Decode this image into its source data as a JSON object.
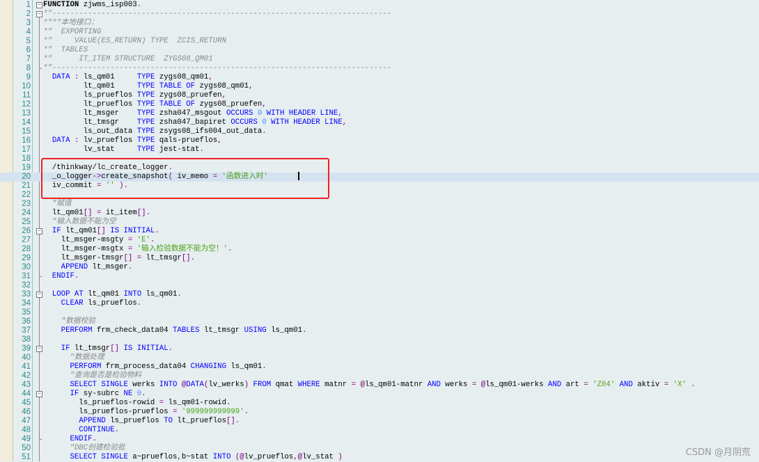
{
  "editor": {
    "current_line": 20,
    "fold_open_lines": [
      1,
      2,
      26,
      33,
      39,
      44
    ],
    "fold_end_lines": [
      8,
      31,
      49
    ],
    "highlighted_lines": [
      19,
      21
    ],
    "lines": [
      [
        [
          "kb",
          "FUNCTION"
        ],
        [
          "t",
          " zjwms_isp003"
        ],
        [
          "o",
          "."
        ]
      ],
      [
        [
          "c",
          "*\"----------------------------------------------------------------------------"
        ]
      ],
      [
        [
          "c",
          "*\"*\"本地接口："
        ]
      ],
      [
        [
          "c",
          "*\"  EXPORTING"
        ]
      ],
      [
        [
          "c",
          "*\"     VALUE(ES_RETURN) TYPE  ZCIS_RETURN"
        ]
      ],
      [
        [
          "c",
          "*\"  TABLES"
        ]
      ],
      [
        [
          "c",
          "*\"      IT_ITEM STRUCTURE  ZYGS08_QM01"
        ]
      ],
      [
        [
          "c",
          "*\"----------------------------------------------------------------------------"
        ]
      ],
      [
        [
          "t",
          "  "
        ],
        [
          "k",
          "DATA"
        ],
        [
          "t",
          " "
        ],
        [
          "o",
          ":"
        ],
        [
          "t",
          " ls_qm01     "
        ],
        [
          "k",
          "TYPE"
        ],
        [
          "t",
          " zygs08_qm01"
        ],
        [
          "o",
          ","
        ]
      ],
      [
        [
          "t",
          "         lt_qm01     "
        ],
        [
          "k",
          "TYPE"
        ],
        [
          "t",
          " "
        ],
        [
          "k",
          "TABLE OF"
        ],
        [
          "t",
          " zygs08_qm01"
        ],
        [
          "o",
          ","
        ]
      ],
      [
        [
          "t",
          "         ls_prueflos "
        ],
        [
          "k",
          "TYPE"
        ],
        [
          "t",
          " zygs08_pruefen"
        ],
        [
          "o",
          ","
        ]
      ],
      [
        [
          "t",
          "         lt_prueflos "
        ],
        [
          "k",
          "TYPE"
        ],
        [
          "t",
          " "
        ],
        [
          "k",
          "TABLE OF"
        ],
        [
          "t",
          " zygs08_pruefen"
        ],
        [
          "o",
          ","
        ]
      ],
      [
        [
          "t",
          "         lt_msger    "
        ],
        [
          "k",
          "TYPE"
        ],
        [
          "t",
          " zsha047_msgout "
        ],
        [
          "k",
          "OCCURS"
        ],
        [
          "t",
          " "
        ],
        [
          "n",
          "0"
        ],
        [
          "t",
          " "
        ],
        [
          "k",
          "WITH HEADER LINE"
        ],
        [
          "o",
          ","
        ]
      ],
      [
        [
          "t",
          "         lt_tmsgr    "
        ],
        [
          "k",
          "TYPE"
        ],
        [
          "t",
          " zsha047_bapiret "
        ],
        [
          "k",
          "OCCURS"
        ],
        [
          "t",
          " "
        ],
        [
          "n",
          "0"
        ],
        [
          "t",
          " "
        ],
        [
          "k",
          "WITH HEADER LINE"
        ],
        [
          "o",
          ","
        ]
      ],
      [
        [
          "t",
          "         ls_out_data "
        ],
        [
          "k",
          "TYPE"
        ],
        [
          "t",
          " zsygs08_ifs004_out_data"
        ],
        [
          "o",
          "."
        ]
      ],
      [
        [
          "t",
          "  "
        ],
        [
          "k",
          "DATA"
        ],
        [
          "t",
          " "
        ],
        [
          "o",
          ":"
        ],
        [
          "t",
          " lv_prueflos "
        ],
        [
          "k",
          "TYPE"
        ],
        [
          "t",
          " qals-prueflos"
        ],
        [
          "o",
          ","
        ]
      ],
      [
        [
          "t",
          "         lv_stat     "
        ],
        [
          "k",
          "TYPE"
        ],
        [
          "t",
          " jest-stat"
        ],
        [
          "o",
          "."
        ]
      ],
      [],
      [
        [
          "t",
          "  /thinkway/lc_create_logger"
        ],
        [
          "o",
          "."
        ]
      ],
      [
        [
          "t",
          "  _o_logger"
        ],
        [
          "o",
          "->"
        ],
        [
          "t",
          "create_snapshot"
        ],
        [
          "o",
          "("
        ],
        [
          "t",
          " iv_memo "
        ],
        [
          "o",
          "="
        ],
        [
          "t",
          " "
        ],
        [
          "s",
          "'函数进入时'"
        ]
      ],
      [
        [
          "t",
          "  iv_commit "
        ],
        [
          "o",
          "="
        ],
        [
          "t",
          " "
        ],
        [
          "s",
          "''"
        ],
        [
          "t",
          " "
        ],
        [
          "o",
          ")."
        ]
      ],
      [],
      [
        [
          "c",
          "  \"赋值"
        ]
      ],
      [
        [
          "t",
          "  lt_qm01"
        ],
        [
          "o",
          "[]"
        ],
        [
          "t",
          " "
        ],
        [
          "o",
          "="
        ],
        [
          "t",
          " it_item"
        ],
        [
          "o",
          "[]."
        ]
      ],
      [
        [
          "c",
          "  \"输入数据不能为空"
        ]
      ],
      [
        [
          "t",
          "  "
        ],
        [
          "k",
          "IF"
        ],
        [
          "t",
          " lt_qm01"
        ],
        [
          "o",
          "[]"
        ],
        [
          "t",
          " "
        ],
        [
          "k",
          "IS INITIAL"
        ],
        [
          "o",
          "."
        ]
      ],
      [
        [
          "t",
          "    lt_msger-msgty "
        ],
        [
          "o",
          "="
        ],
        [
          "t",
          " "
        ],
        [
          "s",
          "'E'"
        ],
        [
          "o",
          "."
        ]
      ],
      [
        [
          "t",
          "    lt_msger-msgtx "
        ],
        [
          "o",
          "="
        ],
        [
          "t",
          " "
        ],
        [
          "s",
          "'输入检验数据不能为空！'"
        ],
        [
          "o",
          "."
        ]
      ],
      [
        [
          "t",
          "    lt_msger-tmsgr"
        ],
        [
          "o",
          "[]"
        ],
        [
          "t",
          " "
        ],
        [
          "o",
          "="
        ],
        [
          "t",
          " lt_tmsgr"
        ],
        [
          "o",
          "[]."
        ]
      ],
      [
        [
          "t",
          "    "
        ],
        [
          "k",
          "APPEND"
        ],
        [
          "t",
          " lt_msger"
        ],
        [
          "o",
          "."
        ]
      ],
      [
        [
          "t",
          "  "
        ],
        [
          "k",
          "ENDIF"
        ],
        [
          "o",
          "."
        ]
      ],
      [],
      [
        [
          "t",
          "  "
        ],
        [
          "k",
          "LOOP AT"
        ],
        [
          "t",
          " lt_qm01 "
        ],
        [
          "k",
          "INTO"
        ],
        [
          "t",
          " ls_qm01"
        ],
        [
          "o",
          "."
        ]
      ],
      [
        [
          "t",
          "    "
        ],
        [
          "k",
          "CLEAR"
        ],
        [
          "t",
          " ls_prueflos"
        ],
        [
          "o",
          "."
        ]
      ],
      [],
      [
        [
          "c",
          "    \"数据校验"
        ]
      ],
      [
        [
          "t",
          "    "
        ],
        [
          "k",
          "PERFORM"
        ],
        [
          "t",
          " frm_check_data04 "
        ],
        [
          "k",
          "TABLES"
        ],
        [
          "t",
          " lt_tmsgr "
        ],
        [
          "k",
          "USING"
        ],
        [
          "t",
          " ls_qm01"
        ],
        [
          "o",
          "."
        ]
      ],
      [],
      [
        [
          "t",
          "    "
        ],
        [
          "k",
          "IF"
        ],
        [
          "t",
          " lt_tmsgr"
        ],
        [
          "o",
          "[]"
        ],
        [
          "t",
          " "
        ],
        [
          "k",
          "IS INITIAL"
        ],
        [
          "o",
          "."
        ]
      ],
      [
        [
          "c",
          "      \"数据处理"
        ]
      ],
      [
        [
          "t",
          "      "
        ],
        [
          "k",
          "PERFORM"
        ],
        [
          "t",
          " frm_process_data04 "
        ],
        [
          "k",
          "CHANGING"
        ],
        [
          "t",
          " ls_qm01"
        ],
        [
          "o",
          "."
        ]
      ],
      [
        [
          "c",
          "      \"查询是否是检验物料"
        ]
      ],
      [
        [
          "t",
          "      "
        ],
        [
          "k",
          "SELECT SINGLE"
        ],
        [
          "t",
          " werks "
        ],
        [
          "k",
          "INTO"
        ],
        [
          "t",
          " "
        ],
        [
          "o",
          "@"
        ],
        [
          "k",
          "DATA"
        ],
        [
          "o",
          "("
        ],
        [
          "t",
          "lv_werks"
        ],
        [
          "o",
          ")"
        ],
        [
          "t",
          " "
        ],
        [
          "k",
          "FROM"
        ],
        [
          "t",
          " qmat "
        ],
        [
          "k",
          "WHERE"
        ],
        [
          "t",
          " matnr "
        ],
        [
          "o",
          "="
        ],
        [
          "t",
          " "
        ],
        [
          "o",
          "@"
        ],
        [
          "t",
          "ls_qm01-matnr "
        ],
        [
          "k",
          "AND"
        ],
        [
          "t",
          " werks "
        ],
        [
          "o",
          "="
        ],
        [
          "t",
          " "
        ],
        [
          "o",
          "@"
        ],
        [
          "t",
          "ls_qm01-werks "
        ],
        [
          "k",
          "AND"
        ],
        [
          "t",
          " art "
        ],
        [
          "o",
          "="
        ],
        [
          "t",
          " "
        ],
        [
          "s",
          "'Z04'"
        ],
        [
          "t",
          " "
        ],
        [
          "k",
          "AND"
        ],
        [
          "t",
          " aktiv "
        ],
        [
          "o",
          "="
        ],
        [
          "t",
          " "
        ],
        [
          "s",
          "'X'"
        ],
        [
          "t",
          " "
        ],
        [
          "o",
          "."
        ]
      ],
      [
        [
          "t",
          "      "
        ],
        [
          "k",
          "IF"
        ],
        [
          "t",
          " sy-subrc "
        ],
        [
          "k",
          "NE"
        ],
        [
          "t",
          " "
        ],
        [
          "n",
          "0"
        ],
        [
          "o",
          "."
        ]
      ],
      [
        [
          "t",
          "        ls_prueflos-rowid "
        ],
        [
          "o",
          "="
        ],
        [
          "t",
          " ls_qm01-rowid"
        ],
        [
          "o",
          "."
        ]
      ],
      [
        [
          "t",
          "        ls_prueflos-prueflos "
        ],
        [
          "o",
          "="
        ],
        [
          "t",
          " "
        ],
        [
          "s",
          "'999999999999'"
        ],
        [
          "o",
          "."
        ]
      ],
      [
        [
          "t",
          "        "
        ],
        [
          "k",
          "APPEND"
        ],
        [
          "t",
          " ls_prueflos "
        ],
        [
          "k",
          "TO"
        ],
        [
          "t",
          " lt_prueflos"
        ],
        [
          "o",
          "[]."
        ]
      ],
      [
        [
          "t",
          "        "
        ],
        [
          "k",
          "CONTINUE"
        ],
        [
          "o",
          "."
        ]
      ],
      [
        [
          "t",
          "      "
        ],
        [
          "k",
          "ENDIF"
        ],
        [
          "o",
          "."
        ]
      ],
      [
        [
          "c",
          "      \"DBC创建检验批"
        ]
      ],
      [
        [
          "t",
          "      "
        ],
        [
          "k",
          "SELECT SINGLE"
        ],
        [
          "t",
          " a~prueflos"
        ],
        [
          "o",
          ","
        ],
        [
          "t",
          "b~stat "
        ],
        [
          "k",
          "INTO"
        ],
        [
          "t",
          " "
        ],
        [
          "o",
          "(@"
        ],
        [
          "t",
          "lv_prueflos"
        ],
        [
          "o",
          ",@"
        ],
        [
          "t",
          "lv_stat "
        ],
        [
          "o",
          ")"
        ]
      ]
    ]
  },
  "watermark": "CSDN @月阴荒",
  "colors": {
    "keyword": "#0000ff",
    "string": "#4aa31b",
    "comment": "#8a8a8a",
    "operator": "#800080",
    "line_number": "#2a8a8a",
    "annotation_box": "#f02020",
    "current_line": "#d5e2ef"
  }
}
